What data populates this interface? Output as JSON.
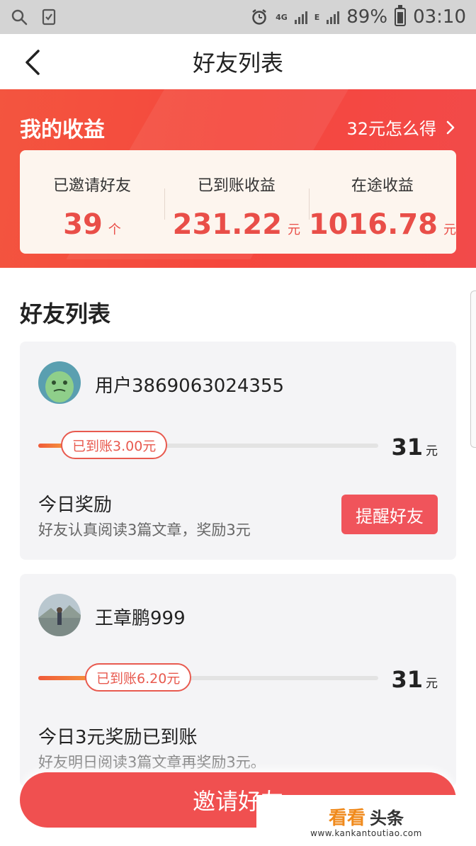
{
  "status_bar": {
    "network_1": "4G",
    "network_2": "E",
    "battery": "89%",
    "time": "03:10"
  },
  "nav": {
    "title": "好友列表"
  },
  "earnings": {
    "title": "我的收益",
    "link_text": "32元怎么得",
    "stats": [
      {
        "label": "已邀请好友",
        "value": "39",
        "unit": "个"
      },
      {
        "label": "已到账收益",
        "value": "231.22",
        "unit": "元"
      },
      {
        "label": "在途收益",
        "value": "1016.78",
        "unit": "元"
      }
    ]
  },
  "friend_list": {
    "heading": "好友列表",
    "friends": [
      {
        "name": "用户3869063024355",
        "received_label": "已到账3.00元",
        "progress_fraction": 0.097,
        "goal_value": "31",
        "goal_unit": "元",
        "reward_title": "今日奖励",
        "reward_desc": "好友认真阅读3篇文章，奖励3元",
        "action_label": "提醒好友"
      },
      {
        "name": "王章鹏999",
        "received_label": "已到账6.20元",
        "progress_fraction": 0.2,
        "goal_value": "31",
        "goal_unit": "元",
        "reward_title": "今日3元奖励已到账",
        "reward_desc": "好友明日阅读3篇文章再奖励3元。"
      }
    ]
  },
  "invite_button": "邀请好友",
  "watermark": {
    "brand_a": "看看",
    "brand_b": "头条",
    "url": "www.kankantoutiao.com"
  }
}
